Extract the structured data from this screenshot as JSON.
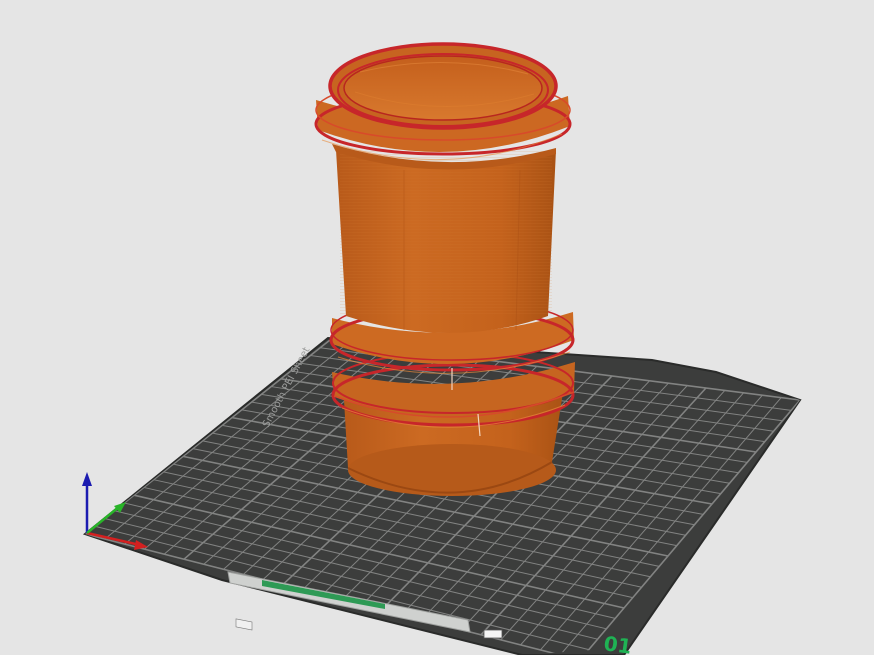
{
  "viewport": {
    "background_color": "#e5e5e5"
  },
  "bed": {
    "surface_color": "#3c3d3c",
    "edge_color": "#2a2b2a",
    "grid_color": "#8a8b8a",
    "texture_text": "Smooth PEI Sheet",
    "label_text": "01",
    "label_color": "#1fb254"
  },
  "model": {
    "body_color": "#c9641e",
    "shade_color": "#a84f15",
    "perimeter_color": "#c7262a",
    "highlight_color": "#e88a3a"
  },
  "axes": {
    "x_color": "#d42020",
    "y_color": "#28b428",
    "z_color": "#1b1bb0"
  }
}
